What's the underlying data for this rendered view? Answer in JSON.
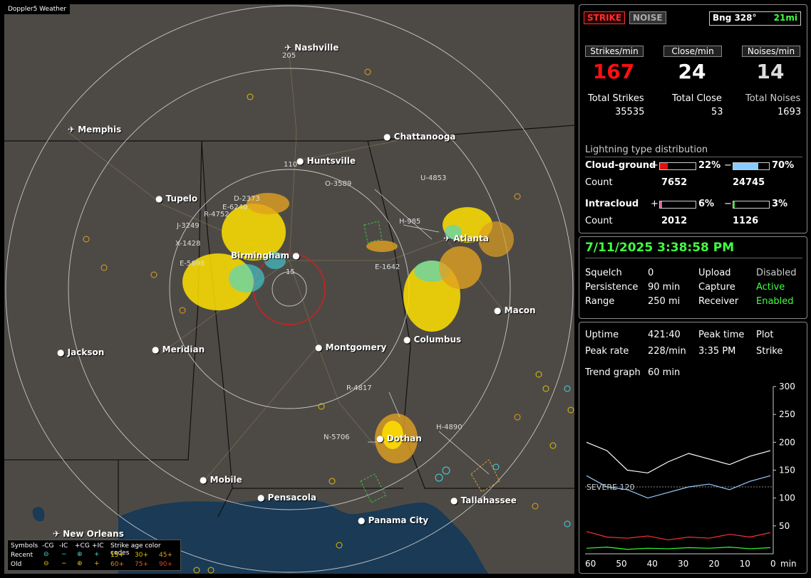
{
  "app": {
    "title": "Doppler5 Weather"
  },
  "map": {
    "ring_labels": [
      "205",
      "110",
      "15"
    ],
    "cities": [
      {
        "name": "Nashville"
      },
      {
        "name": "Memphis"
      },
      {
        "name": "Chattanooga"
      },
      {
        "name": "Huntsville"
      },
      {
        "name": "Tupelo"
      },
      {
        "name": "Birmingham"
      },
      {
        "name": "Atlanta"
      },
      {
        "name": "Macon"
      },
      {
        "name": "Jackson"
      },
      {
        "name": "Meridian"
      },
      {
        "name": "Montgomery"
      },
      {
        "name": "Columbus"
      },
      {
        "name": "Dothan"
      },
      {
        "name": "Mobile"
      },
      {
        "name": "Pensacola"
      },
      {
        "name": "Tallahassee"
      },
      {
        "name": "Panama City"
      },
      {
        "name": "New Orleans"
      }
    ],
    "strike_ids": [
      "D-2373",
      "E-6240",
      "R-4752",
      "J-3249",
      "X-1428",
      "E-5698",
      "O-3589",
      "U-4853",
      "H-985",
      "E-1642",
      "R-4817",
      "N-5706",
      "H-4890"
    ]
  },
  "legend": {
    "symbols_label": "Symbols",
    "cg_neg": "-CG",
    "ic_neg": "-IC",
    "cg_pos": "+CG",
    "ic_pos": "+IC",
    "age_title": "Strike age color codes",
    "recent": "Recent",
    "old": "Old",
    "age_15": "15+",
    "age_30": "30+",
    "age_45": "45+",
    "age_60": "60+",
    "age_75": "75+",
    "age_90": "90+"
  },
  "status": {
    "strike_btn": "STRIKE",
    "noise_btn": "NOISE",
    "bearing": "Bng 328°",
    "distance": "21mi",
    "strikes_per_min_label": "Strikes/min",
    "close_per_min_label": "Close/min",
    "noises_per_min_label": "Noises/min",
    "strikes_per_min": "167",
    "close_per_min": "24",
    "noises_per_min": "14",
    "total_strikes_label": "Total Strikes",
    "total_close_label": "Total Close",
    "total_noises_label": "Total Noises",
    "total_strikes": "35535",
    "total_close": "53",
    "total_noises": "1693",
    "dist_title": "Lightning type distribution",
    "cg_label": "Cloud-ground",
    "plus": "+",
    "minus": "−",
    "cg_pos_pct": "22%",
    "cg_neg_pct": "70%",
    "count_label": "Count",
    "cg_pos_count": "7652",
    "cg_neg_count": "24745",
    "ic_label": "Intracloud",
    "ic_pos_pct": "6%",
    "ic_neg_pct": "3%",
    "ic_pos_count": "2012",
    "ic_neg_count": "1126",
    "cg_pos_level": 0.22,
    "cg_neg_level": 0.7,
    "ic_pos_level": 0.06,
    "ic_neg_level": 0.03
  },
  "settings": {
    "datetime": "7/11/2025 3:38:58 PM",
    "squelch_label": "Squelch",
    "squelch": "0",
    "upload_label": "Upload",
    "upload": "Disabled",
    "persistence_label": "Persistence",
    "persistence": "90 min",
    "capture_label": "Capture",
    "capture": "Active",
    "range_label": "Range",
    "range": "250 mi",
    "receiver_label": "Receiver",
    "receiver": "Enabled"
  },
  "stats": {
    "uptime_label": "Uptime",
    "uptime": "421:40",
    "peak_time_label": "Peak time",
    "peak_time": "3:35 PM",
    "plot_label": "Plot",
    "peak_rate_label": "Peak rate",
    "peak_rate": "228/min",
    "plot": "Strike",
    "trend_label": "Trend graph",
    "trend": "60 min",
    "severe_label": "SEVERE 120"
  },
  "chart_data": {
    "type": "line",
    "x": [
      60,
      50,
      40,
      30,
      20,
      10,
      0
    ],
    "xlabel": "min",
    "x_tick_labels": [
      "60",
      "50",
      "40",
      "30",
      "20",
      "10",
      "0",
      "min"
    ],
    "y_tick_labels": [
      "300",
      "250",
      "200",
      "150",
      "100",
      "50"
    ],
    "ylim": [
      0,
      300
    ],
    "severe_threshold": 120,
    "series": [
      {
        "color": "#ffffff",
        "values": [
          200,
          185,
          150,
          145,
          165,
          180,
          170,
          160,
          175,
          185
        ]
      },
      {
        "color": "#99ccff",
        "values": [
          140,
          120,
          115,
          100,
          110,
          120,
          125,
          115,
          130,
          140
        ]
      },
      {
        "color": "#ff3030",
        "values": [
          40,
          30,
          28,
          32,
          25,
          30,
          28,
          35,
          30,
          38
        ]
      },
      {
        "color": "#30ff30",
        "values": [
          10,
          12,
          8,
          10,
          9,
          11,
          10,
          12,
          9,
          11
        ]
      }
    ]
  }
}
